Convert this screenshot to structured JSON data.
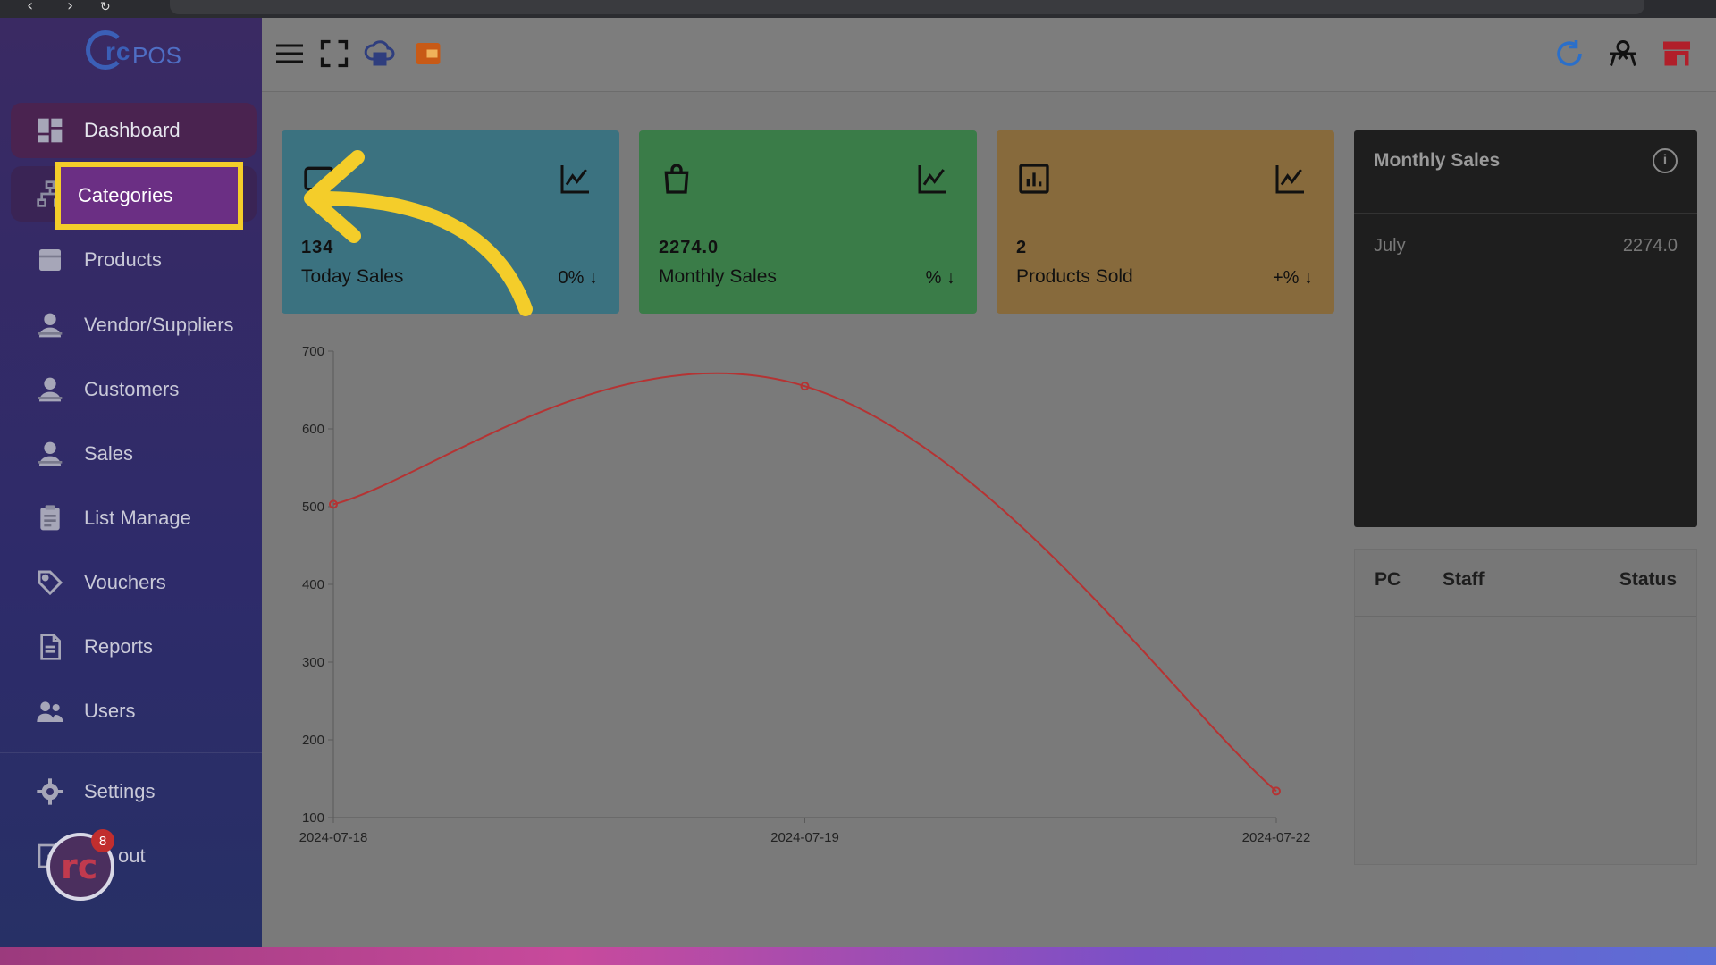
{
  "app": {
    "logo_text": "rc",
    "logo_suffix": "POS"
  },
  "sidebar": {
    "items": [
      {
        "label": "Dashboard",
        "icon": "dashboard-icon"
      },
      {
        "label": "Categories",
        "icon": "sitemap-icon"
      },
      {
        "label": "Products",
        "icon": "box-icon"
      },
      {
        "label": "Vendor/Suppliers",
        "icon": "person-icon"
      },
      {
        "label": "Customers",
        "icon": "person-icon"
      },
      {
        "label": "Sales",
        "icon": "person-icon"
      },
      {
        "label": "List Manage",
        "icon": "clipboard-icon"
      },
      {
        "label": "Vouchers",
        "icon": "tag-icon"
      },
      {
        "label": "Reports",
        "icon": "file-icon"
      },
      {
        "label": "Users",
        "icon": "users-icon"
      },
      {
        "label": "Settings",
        "icon": "gear-icon"
      },
      {
        "label": "out",
        "icon": "logout-icon"
      }
    ],
    "notification_count": "8"
  },
  "cards": [
    {
      "value": "134",
      "label": "Today Sales",
      "change": "0%",
      "color": "#3b7280"
    },
    {
      "value": "2274.0",
      "label": "Monthly Sales",
      "change": "%",
      "color": "#3a7c48"
    },
    {
      "value": "2",
      "label": "Products Sold",
      "change": "+%",
      "color": "#876a3c"
    }
  ],
  "monthly_sales": {
    "title": "Monthly Sales",
    "rows": [
      {
        "month": "July",
        "amount": "2274.0"
      }
    ]
  },
  "staff_table": {
    "columns": [
      "PC",
      "Staff",
      "Status"
    ]
  },
  "chart_data": {
    "type": "line",
    "x": [
      "2024-07-18",
      "2024-07-19",
      "2024-07-22"
    ],
    "series": [
      {
        "values": [
          503,
          655,
          134
        ],
        "color": "#b53333"
      }
    ],
    "ylim": [
      100,
      700
    ],
    "yticks": [
      700,
      600,
      500,
      400,
      300,
      200,
      100
    ],
    "title": "",
    "xlabel": "",
    "ylabel": "",
    "smooth": true,
    "grid": false
  },
  "colors": {
    "highlight": "#f4cd2a",
    "arrow": "#f4cd2a",
    "accent": "#3b5fb6"
  }
}
